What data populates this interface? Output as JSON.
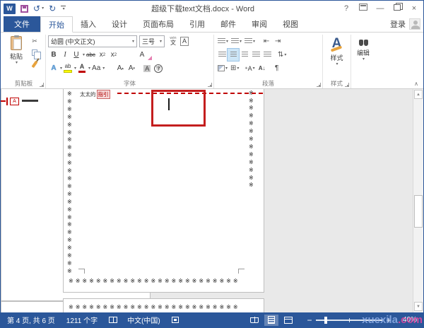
{
  "window": {
    "title": "超级下载text文档.docx - Word",
    "controls": {
      "help": "?",
      "minimize": "—",
      "close": "×"
    }
  },
  "tabs": {
    "file": "文件",
    "items": [
      "开始",
      "插入",
      "设计",
      "页面布局",
      "引用",
      "邮件",
      "审阅",
      "视图"
    ],
    "active": "开始",
    "signin": "登录"
  },
  "ribbon": {
    "clipboard": {
      "paste_label": "粘贴",
      "group_label": "剪贴板"
    },
    "font": {
      "group_label": "字体",
      "font_name": "幼圆 (中文正文)",
      "font_size": "三号"
    },
    "paragraph": {
      "group_label": "段落"
    },
    "styles": {
      "button_label": "样式",
      "group_label": "样式"
    },
    "editing": {
      "button_label": "编辑"
    }
  },
  "icons": {
    "logo_w": "W",
    "undo": "↺",
    "redo": "↻",
    "caret": "▾",
    "caret_up": "▴",
    "scissors": "✂",
    "bold": "B",
    "italic": "I",
    "underline": "U",
    "strike": "abc",
    "sub_x": "x",
    "sub_2": "2",
    "sup_x": "x",
    "sup_2": "2",
    "pinyin_top": "wén",
    "pinyin_bottom": "文",
    "char_border_a": "A",
    "clear_a": "A",
    "effect_a": "A",
    "highlight_ab": "ab",
    "color_a": "A",
    "case_aa": "Aa",
    "grow_a": "A",
    "shrink_a": "A",
    "shade_a": "A",
    "enclose_char": "字",
    "indent_dec": "⇤",
    "indent_inc": "⇥",
    "line_spacing": "⇅",
    "borders": "⊞",
    "asian_a": "A",
    "asian_star": "✳",
    "sort": "A↓",
    "marks": "¶",
    "styles_a": "A",
    "chevron_up": "∧",
    "arrow_up": "▲",
    "arrow_down": "▼",
    "callout_glyph": "A"
  },
  "document": {
    "annotation_prefix": "太太的",
    "annotation_marked": "指引",
    "border_col": "※※※※※※※※※※※※※※※※※※※※※※※※",
    "border_row": "※※※※※※※※※※※※※※※※※※※※※※※※※",
    "border_row_page2": "※※※※※※※※※※※※※※※※※※※※※※※※※"
  },
  "status": {
    "page_info": "第 4 页, 共 6 页",
    "word_count": "1211 个字",
    "language": "中文(中国)",
    "zoom_minus": "−",
    "zoom_plus": "+",
    "zoom_level": "40%",
    "watermark_a": "xuexila",
    "watermark_b": ".com"
  }
}
